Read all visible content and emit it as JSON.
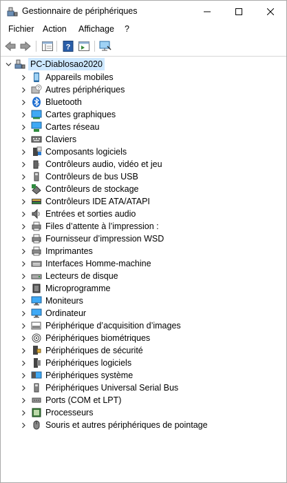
{
  "window": {
    "title": "Gestionnaire de périphériques"
  },
  "menu": {
    "items": [
      "Fichier",
      "Action",
      "Affichage",
      "?"
    ]
  },
  "tree": {
    "root": "PC-Diablosao2020",
    "items": [
      "Appareils mobiles",
      "Autres périphériques",
      "Bluetooth",
      "Cartes graphiques",
      "Cartes réseau",
      "Claviers",
      "Composants logiciels",
      "Contrôleurs audio, vidéo et jeu",
      "Contrôleurs de bus USB",
      "Contrôleurs de stockage",
      "Contrôleurs IDE ATA/ATAPI",
      "Entrées et sorties audio",
      "Files d’attente à l’impression :",
      "Fournisseur d’impression WSD",
      "Imprimantes",
      "Interfaces Homme-machine",
      "Lecteurs de disque",
      "Microprogramme",
      "Moniteurs",
      "Ordinateur",
      "Périphérique d’acquisition d’images",
      "Périphériques biométriques",
      "Périphériques de sécurité",
      "Périphériques logiciels",
      "Périphériques système",
      "Périphériques Universal Serial Bus",
      "Ports (COM et LPT)",
      "Processeurs",
      "Souris et autres périphériques de pointage"
    ],
    "icons": [
      "mobile-device-icon",
      "unknown-device-icon",
      "bluetooth-icon",
      "display-adapter-icon",
      "network-adapter-icon",
      "keyboard-icon",
      "software-component-icon",
      "audio-controller-icon",
      "usb-controller-icon",
      "storage-controller-icon",
      "ide-controller-icon",
      "audio-io-icon",
      "print-queue-icon",
      "wsd-print-provider-icon",
      "printer-icon",
      "hid-icon",
      "disk-drive-icon",
      "firmware-icon",
      "monitor-icon",
      "computer-icon",
      "imaging-device-icon",
      "biometric-icon",
      "security-device-icon",
      "software-device-icon",
      "system-device-icon",
      "usb-device-icon",
      "port-icon",
      "processor-icon",
      "mouse-icon"
    ]
  },
  "colors": {
    "selection": "#cde8ff",
    "accent": "#2b7cd3",
    "bluetooth": "#1f6fd1"
  }
}
